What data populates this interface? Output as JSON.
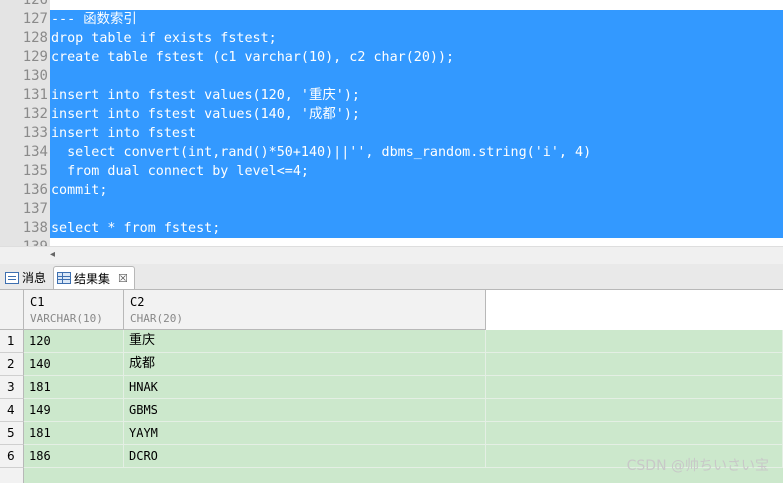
{
  "editor": {
    "lines": [
      {
        "num": "126",
        "code": ""
      },
      {
        "num": "127",
        "code": "--- 函数索引"
      },
      {
        "num": "128",
        "code": "drop table if exists fstest;"
      },
      {
        "num": "129",
        "code": "create table fstest (c1 varchar(10), c2 char(20));"
      },
      {
        "num": "130",
        "code": ""
      },
      {
        "num": "131",
        "code": "insert into fstest values(120, '重庆');"
      },
      {
        "num": "132",
        "code": "insert into fstest values(140, '成都');"
      },
      {
        "num": "133",
        "code": "insert into fstest"
      },
      {
        "num": "134",
        "code": "  select convert(int,rand()*50+140)||'', dbms_random.string('i', 4)"
      },
      {
        "num": "135",
        "code": "  from dual connect by level<=4;"
      },
      {
        "num": "136",
        "code": "commit;"
      },
      {
        "num": "137",
        "code": ""
      },
      {
        "num": "138",
        "code": "select * from fstest;"
      },
      {
        "num": "139",
        "code": ""
      }
    ],
    "selection_color": "#3399ff",
    "hscroll_arrow": "◂"
  },
  "tabs": {
    "messages": {
      "label": "消息",
      "icon": "messages-icon"
    },
    "result_set": {
      "label": "结果集",
      "icon": "grid-icon",
      "close": "☒"
    }
  },
  "grid": {
    "columns": [
      {
        "name": "C1",
        "type": "VARCHAR(10)"
      },
      {
        "name": "C2",
        "type": "CHAR(20)"
      }
    ],
    "rows": [
      {
        "n": "1",
        "c1": "120",
        "c2": "重庆"
      },
      {
        "n": "2",
        "c1": "140",
        "c2": "成都"
      },
      {
        "n": "3",
        "c1": "181",
        "c2": "HNAK"
      },
      {
        "n": "4",
        "c1": "149",
        "c2": "GBMS"
      },
      {
        "n": "5",
        "c1": "181",
        "c2": "YAYM"
      },
      {
        "n": "6",
        "c1": "186",
        "c2": "DCRO"
      }
    ],
    "row_color": "#cce8cc"
  },
  "watermark": "CSDN @帅ちいさい宝"
}
